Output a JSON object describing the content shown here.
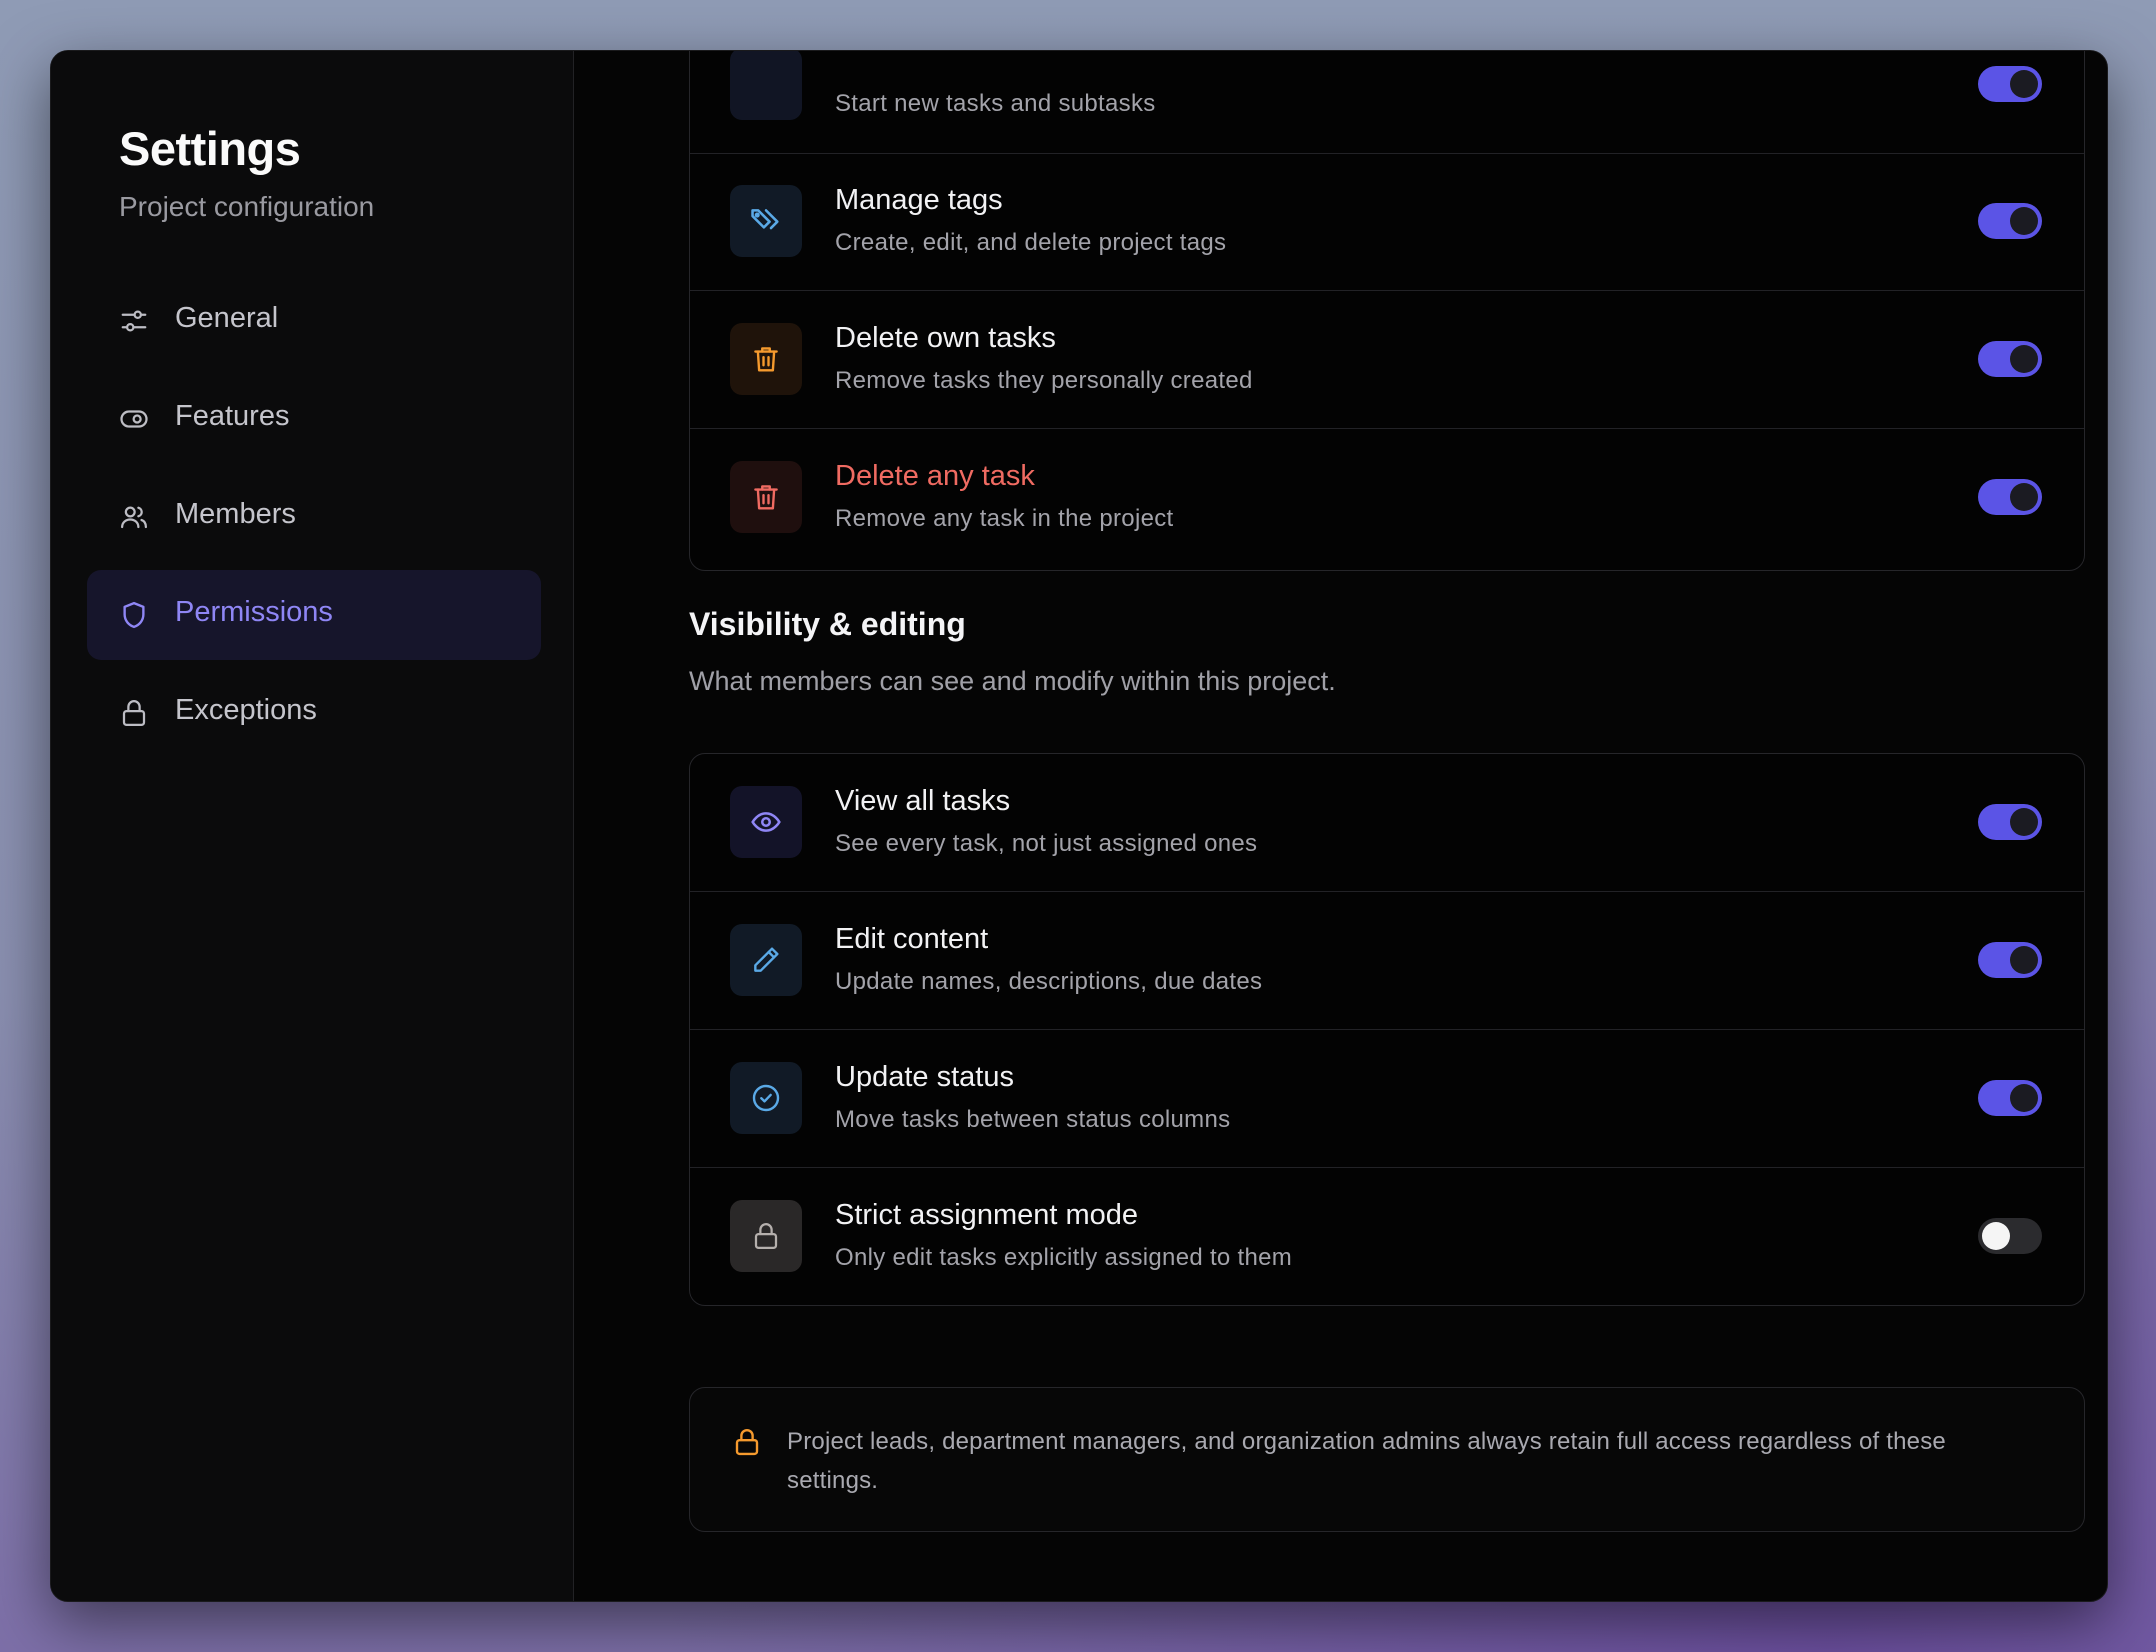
{
  "sidebar": {
    "title": "Settings",
    "subtitle": "Project configuration",
    "items": [
      {
        "label": "General",
        "icon": "sliders-icon",
        "active": false
      },
      {
        "label": "Features",
        "icon": "toggle-icon",
        "active": false
      },
      {
        "label": "Members",
        "icon": "users-icon",
        "active": false
      },
      {
        "label": "Permissions",
        "icon": "shield-icon",
        "active": true
      },
      {
        "label": "Exceptions",
        "icon": "lock-icon",
        "active": false
      }
    ]
  },
  "content": {
    "close_icon": "close-icon",
    "task_permissions": {
      "rows": [
        {
          "title": "",
          "desc": "Start new tasks and subtasks",
          "enabled": true,
          "icon": "plus-icon"
        },
        {
          "title": "Manage tags",
          "desc": "Create, edit, and delete project tags",
          "enabled": true,
          "icon": "tag-icon"
        },
        {
          "title": "Delete own tasks",
          "desc": "Remove tasks they personally created",
          "enabled": true,
          "icon": "trash-icon"
        },
        {
          "title": "Delete any task",
          "desc": "Remove any task in the project",
          "enabled": true,
          "icon": "trash-icon",
          "danger": true
        }
      ]
    },
    "visibility": {
      "title": "Visibility & editing",
      "description": "What members can see and modify within this project.",
      "rows": [
        {
          "title": "View all tasks",
          "desc": "See every task, not just assigned ones",
          "enabled": true,
          "icon": "eye-icon"
        },
        {
          "title": "Edit content",
          "desc": "Update names, descriptions, due dates",
          "enabled": true,
          "icon": "pencil-icon"
        },
        {
          "title": "Update status",
          "desc": "Move tasks between status columns",
          "enabled": true,
          "icon": "check-circle-icon"
        },
        {
          "title": "Strict assignment mode",
          "desc": "Only edit tasks explicitly assigned to them",
          "enabled": false,
          "icon": "lock-icon"
        }
      ]
    },
    "notice": {
      "text": "Project leads, department managers, and organization admins always retain full access regardless of these settings.",
      "icon": "lock-icon"
    }
  },
  "colors": {
    "accent": "#5b54e6",
    "active_nav_text": "#8f86f5",
    "danger": "#f06b62",
    "warning": "#f59a2e",
    "info": "#5aa9e6"
  }
}
